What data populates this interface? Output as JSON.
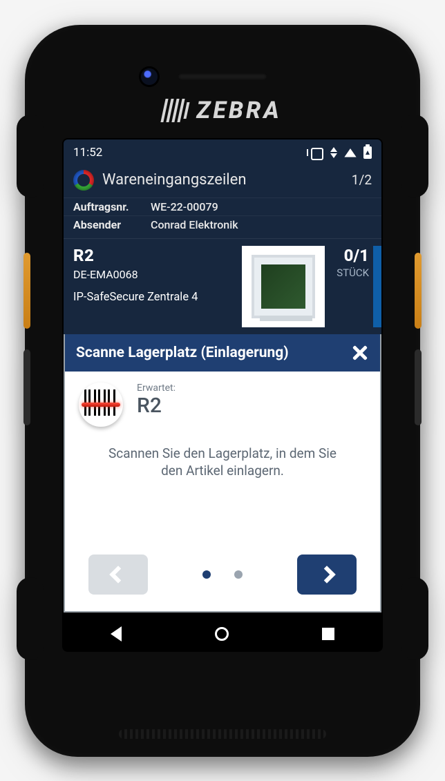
{
  "device": {
    "brand": "ZEBRA"
  },
  "statusbar": {
    "time": "11:52"
  },
  "header": {
    "title": "Wareneingangszeilen",
    "page_counter": "1/2"
  },
  "meta": {
    "order_label": "Auftragsnr.",
    "order_value": "WE-22-00079",
    "sender_label": "Absender",
    "sender_value": "Conrad Elektronik"
  },
  "line": {
    "bin": "R2",
    "sku": "DE-EMA0068",
    "name": "IP-SafeSecure Zentrale 4",
    "qty": "0/1",
    "uom": "STÜCK"
  },
  "panel": {
    "title": "Scanne Lagerplatz (Einlagerung)",
    "expected_label": "Erwartet:",
    "expected_value": "R2",
    "help": "Scannen Sie den Lagerplatz, in dem Sie\nden Artikel einlagern."
  }
}
